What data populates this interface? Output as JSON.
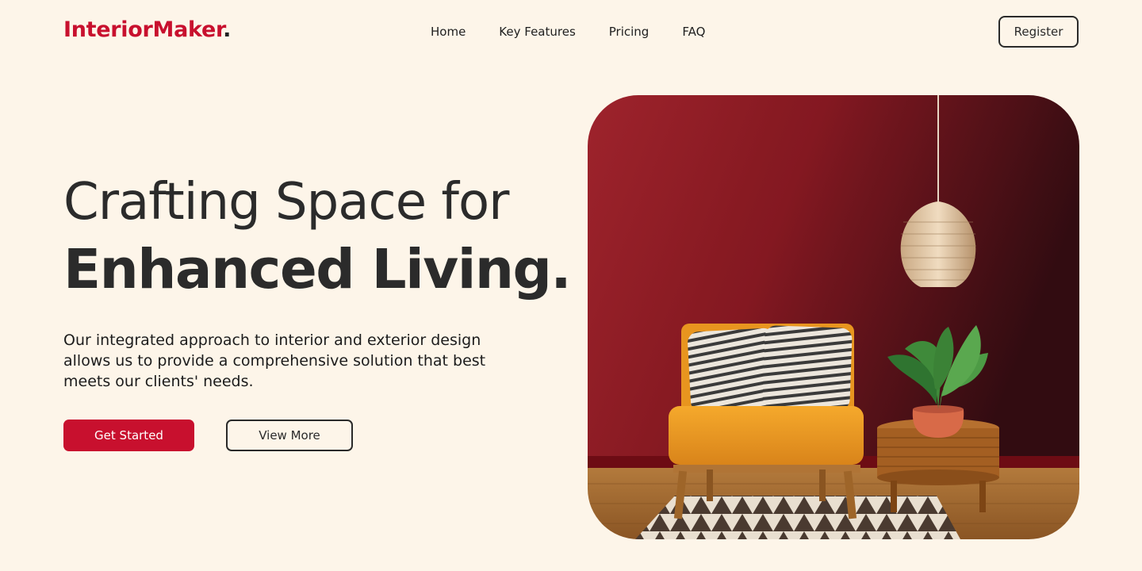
{
  "header": {
    "logo_text": "InteriorMaker",
    "logo_dot": ".",
    "nav": {
      "home": "Home",
      "features": "Key Features",
      "pricing": "Pricing",
      "faq": "FAQ"
    },
    "register_label": "Register"
  },
  "hero": {
    "headline_light": "Crafting Space for",
    "headline_bold": "Enhanced Living.",
    "description": "Our integrated approach to interior and exterior design allows us to provide a comprehensive solution that best meets our clients' needs.",
    "primary_button": "Get Started",
    "secondary_button": "View More",
    "image_icon": "interior-photo"
  },
  "colors": {
    "brand": "#c8102e",
    "background": "#fdf5e9",
    "text": "#2a2a2a"
  }
}
